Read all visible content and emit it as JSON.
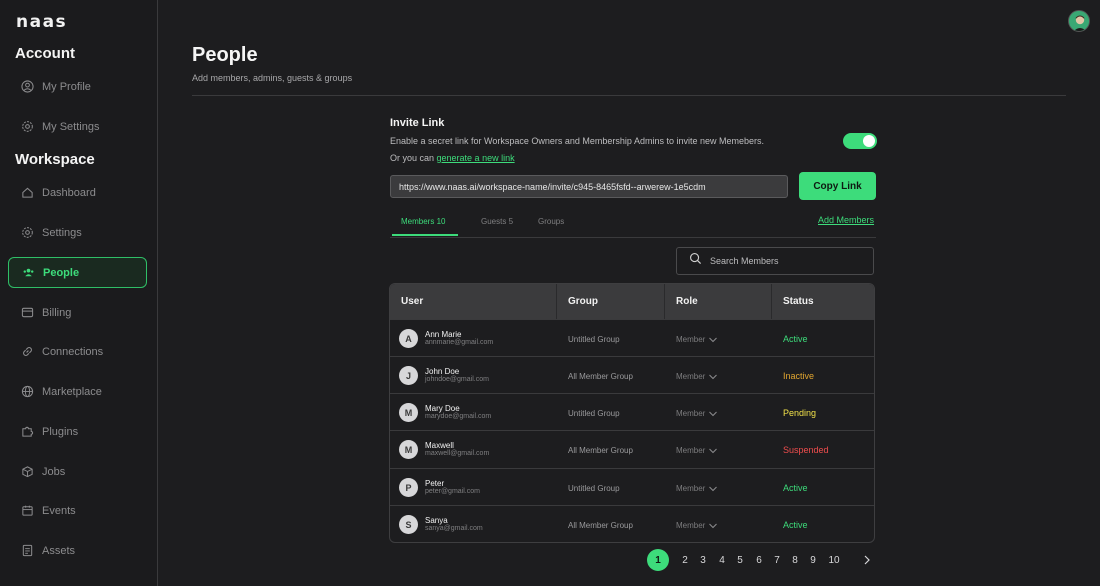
{
  "app": {
    "logo": "naas"
  },
  "sidebar": {
    "account_title": "Account",
    "account_items": [
      {
        "label": "My Profile",
        "icon": "user-circle-icon"
      },
      {
        "label": "My Settings",
        "icon": "gear-icon"
      }
    ],
    "workspace_title": "Workspace",
    "workspace_items": [
      {
        "label": "Dashboard",
        "icon": "home-icon"
      },
      {
        "label": "Settings",
        "icon": "gear-icon"
      },
      {
        "label": "People",
        "icon": "people-icon",
        "active": true
      },
      {
        "label": "Billing",
        "icon": "billing-icon"
      },
      {
        "label": "Connections",
        "icon": "link-icon"
      },
      {
        "label": "Marketplace",
        "icon": "globe-icon"
      },
      {
        "label": "Plugins",
        "icon": "puzzle-icon"
      },
      {
        "label": "Jobs",
        "icon": "box-icon"
      },
      {
        "label": "Events",
        "icon": "calendar-icon"
      },
      {
        "label": "Assets",
        "icon": "document-icon"
      }
    ]
  },
  "header": {
    "title": "People",
    "subtitle": "Add members, admins, guests & groups"
  },
  "invite": {
    "title": "Invite Link",
    "description": "Enable a secret link for Workspace Owners and Membership Admins to invite new Memebers.",
    "generate_prefix": "Or you can ",
    "generate_link": "generate a new link",
    "enabled": true,
    "url": "https://www.naas.ai/workspace-name/invite/c945-8465fsfd--arwerew-1e5cdm",
    "copy_label": "Copy Link"
  },
  "tabs": [
    {
      "label": "Members 10",
      "active": true
    },
    {
      "label": "Guests 5"
    },
    {
      "label": "Groups"
    }
  ],
  "add_members_label": "Add Members",
  "search": {
    "placeholder": "Search Members"
  },
  "table": {
    "columns": [
      "User",
      "Group",
      "Role",
      "Status"
    ],
    "rows": [
      {
        "initial": "A",
        "name": "Ann Marie",
        "email": "annmarie@gmail.com",
        "group": "Untitled Group",
        "role": "Member",
        "status": "Active"
      },
      {
        "initial": "J",
        "name": "John Doe",
        "email": "johndoe@gmail.com",
        "group": "All Member Group",
        "role": "Member",
        "status": "Inactive"
      },
      {
        "initial": "M",
        "name": "Mary Doe",
        "email": "marydoe@gmail.com",
        "group": "Untitled Group",
        "role": "Member",
        "status": "Pending"
      },
      {
        "initial": "M",
        "name": "Maxwell",
        "email": "maxwell@gmail.com",
        "group": "All Member Group",
        "role": "Member",
        "status": "Suspended"
      },
      {
        "initial": "P",
        "name": "Peter",
        "email": "peter@gmail.com",
        "group": "Untitled Group",
        "role": "Member",
        "status": "Active"
      },
      {
        "initial": "S",
        "name": "Sanya",
        "email": "sanya@gmail.com",
        "group": "All Member Group",
        "role": "Member",
        "status": "Active"
      }
    ]
  },
  "status_colors": {
    "Active": "#3ddc7b",
    "Inactive": "#e0a530",
    "Pending": "#f2e24a",
    "Suspended": "#ef4d4d"
  },
  "pagination": {
    "pages": [
      "1",
      "2",
      "3",
      "4",
      "5",
      "6",
      "7",
      "8",
      "9",
      "10"
    ],
    "current": "1"
  },
  "colors": {
    "accent": "#3ddc7b",
    "background": "#1d1d1f"
  }
}
